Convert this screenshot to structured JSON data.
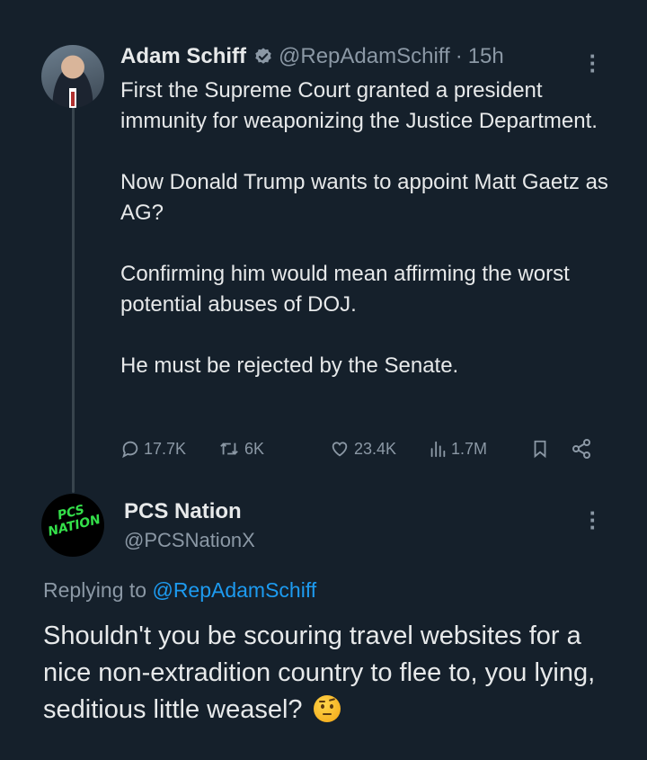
{
  "tweet1": {
    "author_name": "Adam Schiff",
    "handle": "@RepAdamSchiff",
    "separator": "·",
    "time": "15h",
    "paragraphs": [
      "First the Supreme Court granted a president immunity for weaponizing the Justice Department.",
      "Now Donald Trump wants to appoint Matt Gaetz as AG?",
      "Confirming him would mean affirming the worst potential abuses of DOJ.",
      "He must be rejected by the Senate."
    ],
    "stats": {
      "replies": "17.7K",
      "reposts": "6K",
      "likes": "23.4K",
      "views": "1.7M"
    }
  },
  "tweet2": {
    "author_name": "PCS Nation",
    "handle": "@PCSNationX",
    "avatar_logo": [
      "PCS",
      "NATION"
    ],
    "replying_prefix": "Replying to ",
    "replying_to": "@RepAdamSchiff",
    "text": "Shouldn't you be scouring travel websites for a nice non-extradition country to flee to, you lying, seditious little weasel?"
  },
  "colors": {
    "background": "#15202b",
    "text": "#e7e9ea",
    "secondary": "#8b98a5",
    "link": "#1d9bf0",
    "verified": "#1d9bf0"
  }
}
